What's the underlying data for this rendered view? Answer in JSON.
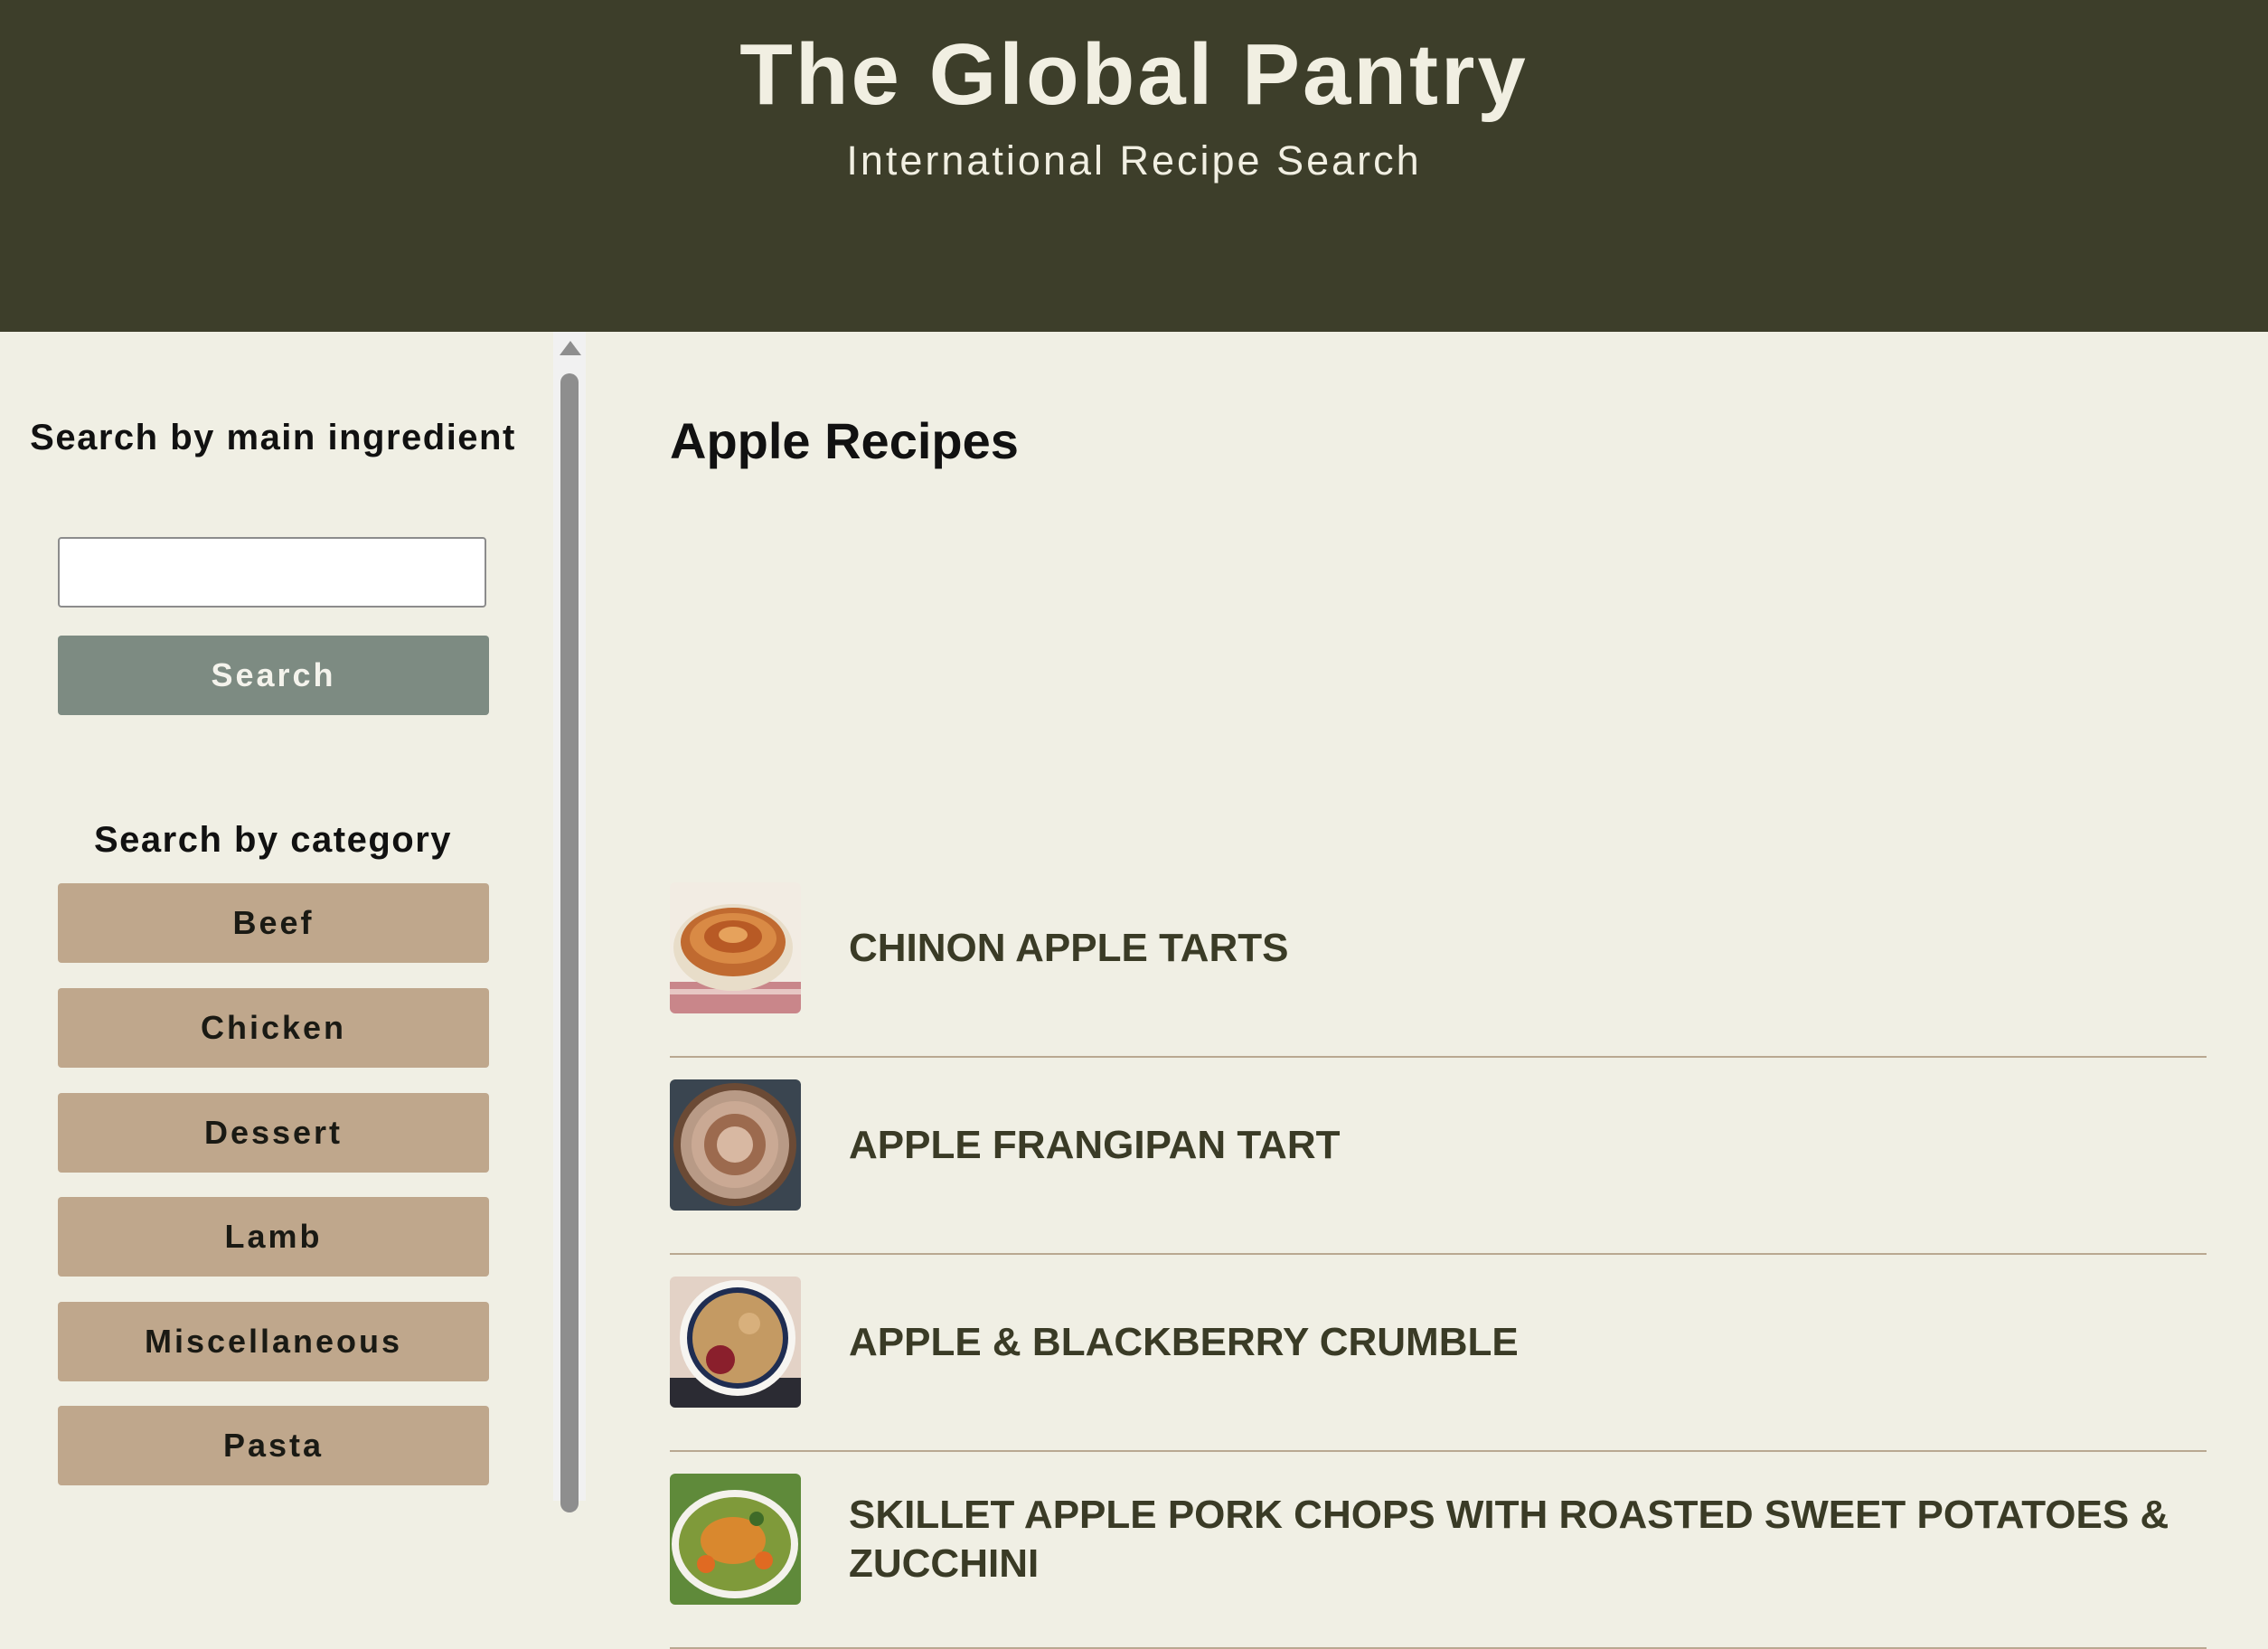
{
  "header": {
    "title": "The Global Pantry",
    "subtitle": "International Recipe Search"
  },
  "sidebar": {
    "ingredient_heading": "Search by main ingredient",
    "search_input_value": "",
    "search_label": "Search",
    "category_heading": "Search by category",
    "categories": [
      "Beef",
      "Chicken",
      "Dessert",
      "Lamb",
      "Miscellaneous",
      "Pasta"
    ]
  },
  "main": {
    "title": "Apple Recipes",
    "recipes": [
      {
        "name": "CHINON APPLE TARTS",
        "thumb": "apple-tart-photo"
      },
      {
        "name": "APPLE FRANGIPAN TART",
        "thumb": "frangipane-tart-photo"
      },
      {
        "name": "APPLE & BLACKBERRY CRUMBLE",
        "thumb": "crumble-photo"
      },
      {
        "name": "SKILLET APPLE PORK CHOPS WITH ROASTED SWEET POTATOES & ZUCCHINI",
        "thumb": "pork-chops-photo"
      }
    ]
  },
  "colors": {
    "header_bg": "#3d3e2a",
    "page_bg": "#f0efe4",
    "search_button": "#7d8b82",
    "category_button": "#bfa78c",
    "recipe_title": "#3a3b26",
    "divider": "#b9a891"
  }
}
